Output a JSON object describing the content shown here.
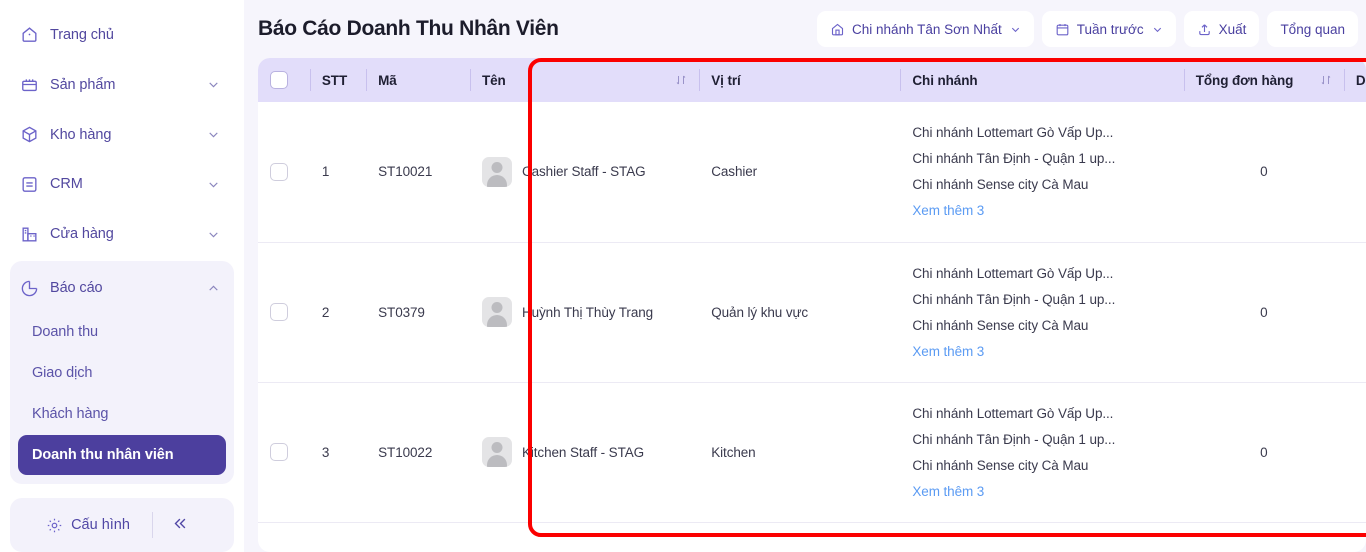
{
  "sidebar": {
    "items": [
      {
        "label": "Trang chủ",
        "icon": "home-icon",
        "expandable": false
      },
      {
        "label": "Sản phẩm",
        "icon": "box-product-icon",
        "expandable": true
      },
      {
        "label": "Kho hàng",
        "icon": "cube-warehouse-icon",
        "expandable": true
      },
      {
        "label": "CRM",
        "icon": "list-card-icon",
        "expandable": true
      },
      {
        "label": "Cửa hàng",
        "icon": "store-icon",
        "expandable": true
      }
    ],
    "report_group": {
      "label": "Báo cáo",
      "icon": "pie-chart-icon",
      "expanded": true,
      "sub_items": [
        {
          "label": "Doanh thu",
          "active": false
        },
        {
          "label": "Giao dịch",
          "active": false
        },
        {
          "label": "Khách hàng",
          "active": false
        },
        {
          "label": "Doanh thu nhân viên",
          "active": true
        }
      ]
    },
    "footer": {
      "config_label": "Cấu hình",
      "config_icon": "gear-settings-icon",
      "collapse_icon": "double-chevron-left-icon"
    }
  },
  "header": {
    "title": "Báo Cáo Doanh Thu Nhân Viên",
    "branch_filter": {
      "label": "Chi nhánh Tân Sơn Nhất",
      "icon": "store-home-icon",
      "chevron": "chevron-down-icon"
    },
    "date_filter": {
      "label": "Tuần trước",
      "icon": "calendar-icon",
      "chevron": "chevron-down-icon"
    },
    "export_button": {
      "label": "Xuất",
      "icon": "upload-export-icon"
    },
    "overview_button": {
      "label": "Tổng quan"
    }
  },
  "table": {
    "columns": [
      {
        "key": "checkbox",
        "label": "",
        "sortable": false
      },
      {
        "key": "stt",
        "label": "STT",
        "sortable": false
      },
      {
        "key": "ma",
        "label": "Mã",
        "sortable": false
      },
      {
        "key": "ten",
        "label": "Tên",
        "sortable": true
      },
      {
        "key": "vitri",
        "label": "Vị trí",
        "sortable": false
      },
      {
        "key": "chinhanh",
        "label": "Chi nhánh",
        "sortable": false
      },
      {
        "key": "tongdonhang",
        "label": "Tổng đơn hàng",
        "sortable": true
      },
      {
        "key": "doanhthu",
        "label": "Doa",
        "sortable": false
      }
    ],
    "more_link_label": "Xem thêm 3",
    "rows": [
      {
        "stt": "1",
        "ma": "ST10021",
        "ten": "Cashier Staff - STAG",
        "vitri": "Cashier",
        "branches": [
          "Chi nhánh Lottemart Gò Vấp Up...",
          "Chi nhánh Tân Định - Quận 1 up...",
          "Chi nhánh Sense city Cà Mau"
        ],
        "more": "Xem thêm 3",
        "tongdonhang": "0"
      },
      {
        "stt": "2",
        "ma": "ST0379",
        "ten": "Huỳnh Thị Thùy Trang",
        "vitri": "Quản lý khu vực",
        "branches": [
          "Chi nhánh Lottemart Gò Vấp Up...",
          "Chi nhánh Tân Định - Quận 1 up...",
          "Chi nhánh Sense city Cà Mau"
        ],
        "more": "Xem thêm 3",
        "tongdonhang": "0"
      },
      {
        "stt": "3",
        "ma": "ST10022",
        "ten": "Kitchen Staff - STAG",
        "vitri": "Kitchen",
        "branches": [
          "Chi nhánh Lottemart Gò Vấp Up...",
          "Chi nhánh Tân Định - Quận 1 up...",
          "Chi nhánh Sense city Cà Mau"
        ],
        "more": "Xem thêm 3",
        "tongdonhang": "0"
      }
    ]
  },
  "annotation": {
    "type": "red-rectangle-highlight",
    "color": "#fb0000"
  },
  "colors": {
    "accent": "#4c3f9e",
    "sidebar_text": "#52489f",
    "table_header_bg": "#e2ddfa",
    "link": "#5b9bf3",
    "page_bg": "#f6f5fc"
  }
}
